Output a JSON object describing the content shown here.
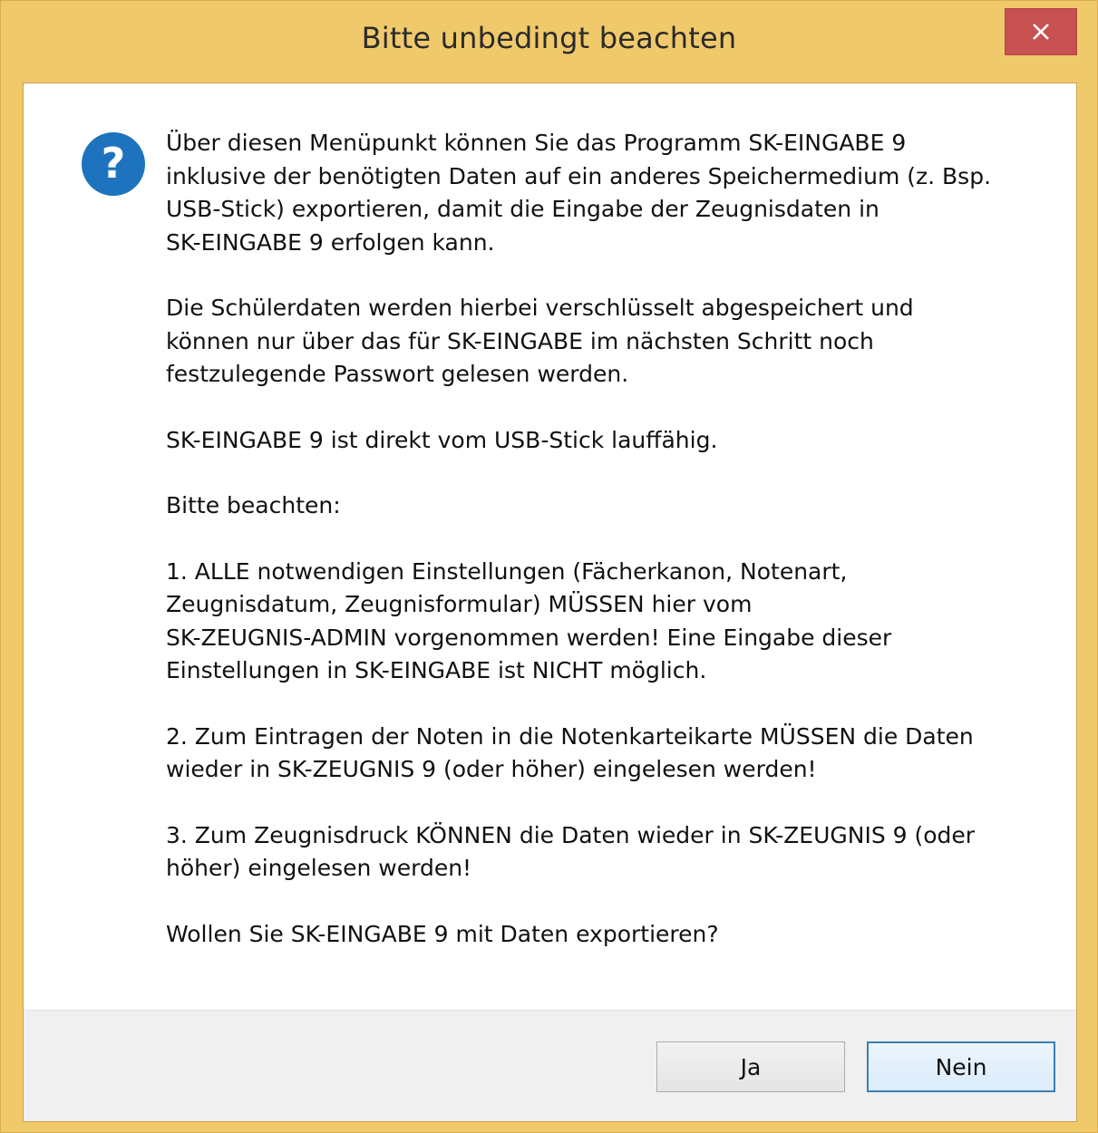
{
  "dialog": {
    "title": "Bitte unbedingt beachten",
    "close_glyph": "×",
    "icon": "question-icon",
    "paragraphs": [
      "Über diesen Menüpunkt können Sie das Programm SK-EINGABE 9\ninklusive der benötigten Daten auf ein anderes Speichermedium (z. Bsp.\nUSB-Stick) exportieren, damit die Eingabe der Zeugnisdaten in\nSK-EINGABE 9 erfolgen kann.",
      "Die Schülerdaten werden hierbei verschlüsselt abgespeichert und\nkönnen nur über das für SK-EINGABE im nächsten Schritt noch\nfestzulegende Passwort gelesen werden.",
      "SK-EINGABE 9 ist direkt vom USB-Stick lauffähig.",
      "Bitte beachten:",
      "1. ALLE notwendigen Einstellungen (Fächerkanon, Notenart,\nZeugnisdatum, Zeugnisformular) MÜSSEN hier vom\nSK-ZEUGNIS-ADMIN vorgenommen werden! Eine Eingabe dieser\nEinstellungen in SK-EINGABE ist NICHT möglich.",
      "2. Zum Eintragen der Noten in die Notenkarteikarte MÜSSEN die Daten\nwieder in SK-ZEUGNIS 9 (oder höher) eingelesen werden!",
      "3. Zum Zeugnisdruck KÖNNEN die Daten wieder in SK-ZEUGNIS 9 (oder\nhöher) eingelesen werden!",
      "Wollen Sie SK-EINGABE 9 mit Daten exportieren?"
    ],
    "buttons": {
      "yes": "Ja",
      "no": "Nein"
    }
  },
  "colors": {
    "titlebar": "#f0c96b",
    "close_button": "#c75050",
    "icon_blue": "#1e73be",
    "default_button_border": "#3c7fb1"
  }
}
